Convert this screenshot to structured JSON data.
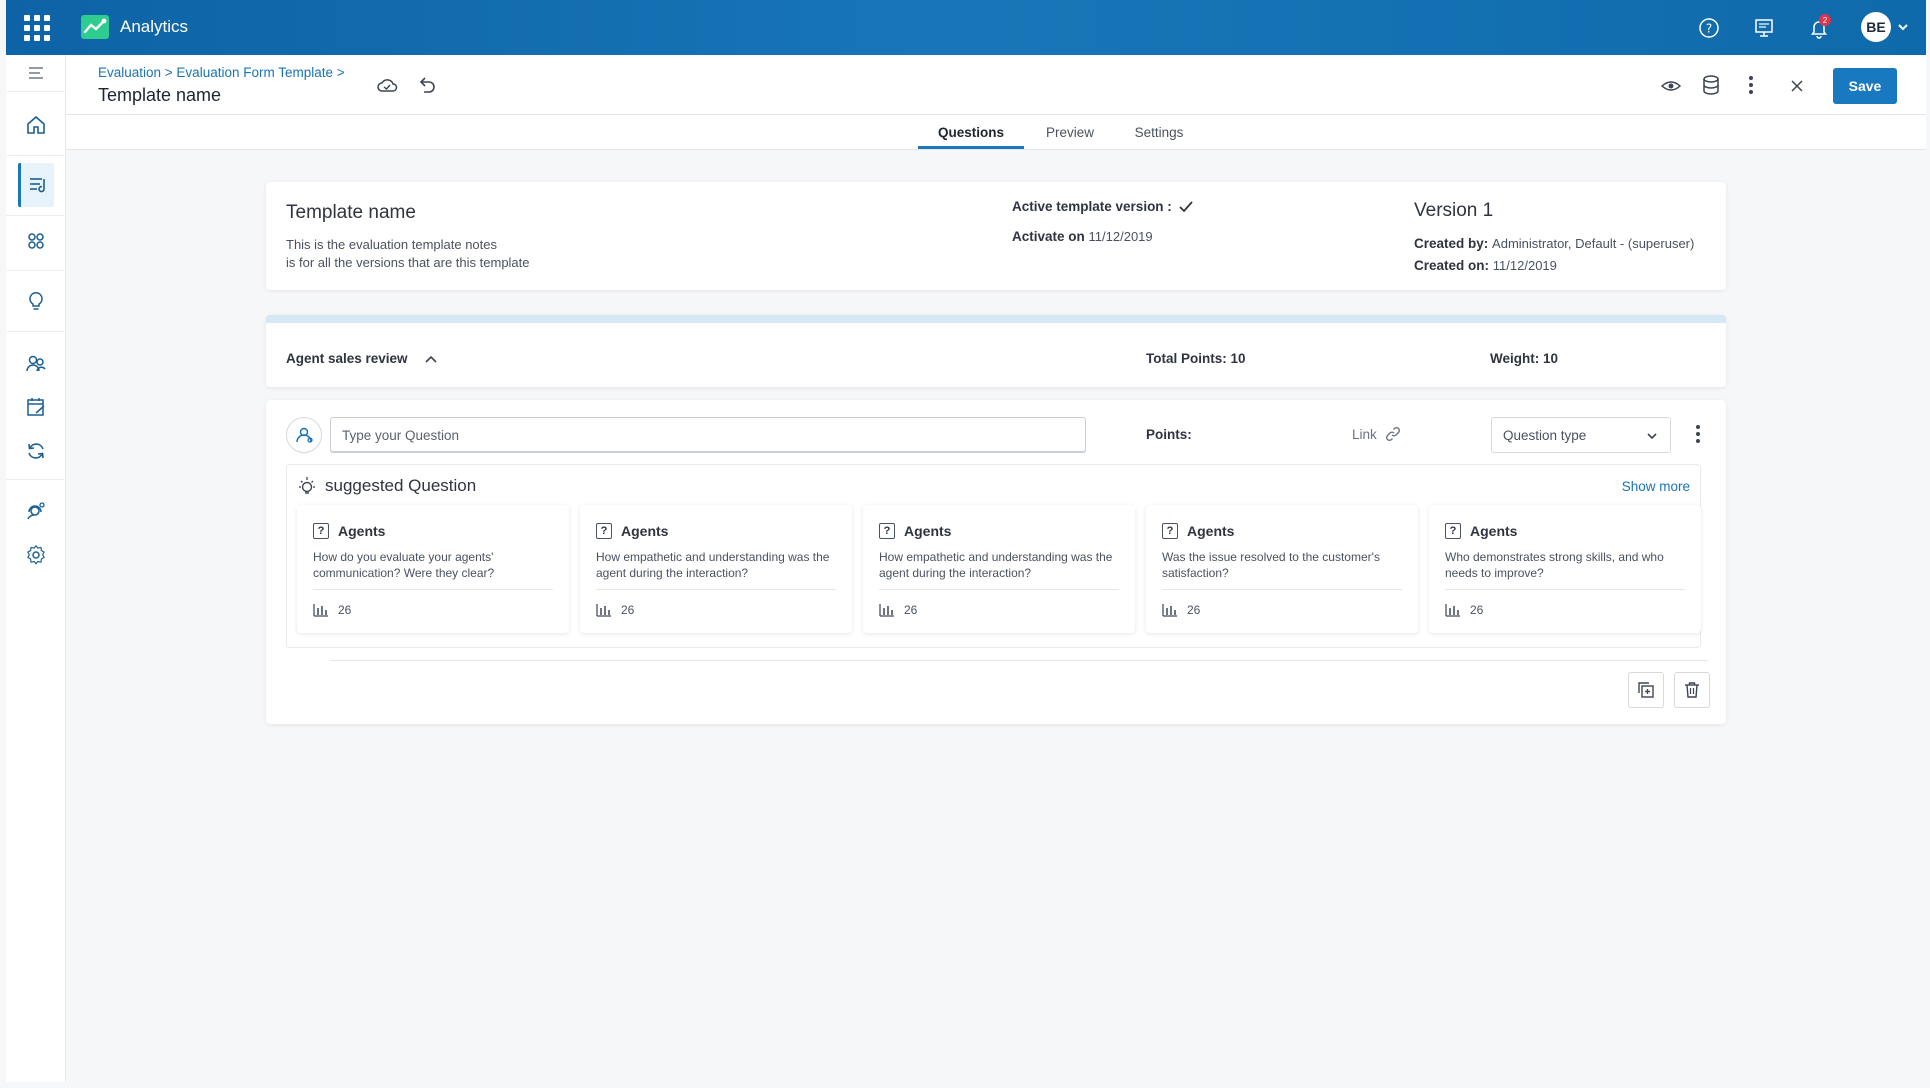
{
  "app": {
    "title": "Analytics",
    "notification_count": "2",
    "user_initials": "BE"
  },
  "header": {
    "breadcrumb": "Evaluation > Evaluation Form Template >",
    "title": "Template name",
    "save_label": "Save"
  },
  "tabs": [
    {
      "label": "Questions"
    },
    {
      "label": "Preview"
    },
    {
      "label": "Settings"
    }
  ],
  "template": {
    "name": "Template name",
    "notes_line1": "This is the evaluation template notes",
    "notes_line2": "is for all the versions that are this template",
    "active_label": "Active template version :",
    "activate_label": "Activate on",
    "activate_date": "11/12/2019",
    "version": "Version 1",
    "created_by_label": "Created by:",
    "created_by": "Administrator, Default - (superuser)",
    "created_on_label": "Created on:",
    "created_on": "11/12/2019"
  },
  "section": {
    "title": "Agent sales review",
    "total_points": "Total Points: 10",
    "weight": "Weight: 10"
  },
  "question": {
    "placeholder": "Type your Question",
    "points_label": "Points:",
    "link_label": "Link",
    "type_placeholder": "Question type"
  },
  "suggested": {
    "title": "suggested Question",
    "show_more": "Show more",
    "items": [
      {
        "category": "Agents",
        "text": "How do you evaluate your agents' communication? Were they clear?",
        "count": "26"
      },
      {
        "category": "Agents",
        "text": "How empathetic and understanding was the agent during the interaction?",
        "count": "26"
      },
      {
        "category": "Agents",
        "text": "How empathetic and understanding was the agent during the interaction?",
        "count": "26"
      },
      {
        "category": "Agents",
        "text": "Was the issue resolved to the customer's satisfaction?",
        "count": "26"
      },
      {
        "category": "Agents",
        "text": "Who demonstrates strong skills, and who needs to improve?",
        "count": "26"
      }
    ]
  },
  "colors": {
    "primary": "#1878c0",
    "header": "#0d63a5",
    "accent_green": "#2ecc8f"
  }
}
